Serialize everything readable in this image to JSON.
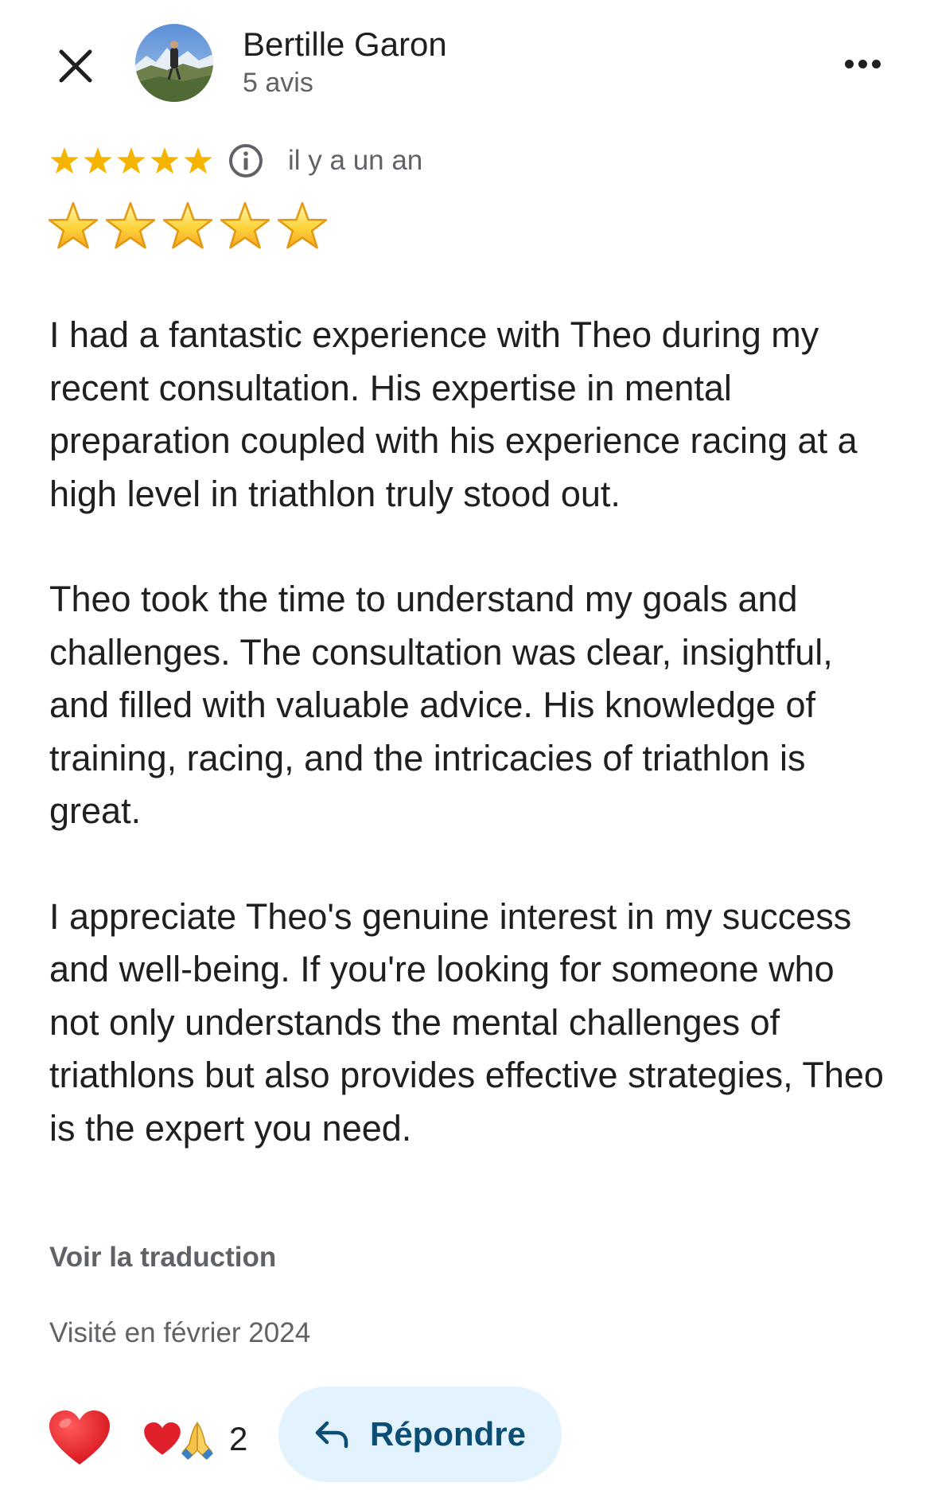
{
  "header": {
    "close_icon": "close-icon",
    "reviewer_name": "Bertille Garon",
    "review_count": "5 avis",
    "more_icon": "more-horizontal-icon"
  },
  "rating": {
    "stars": 5,
    "max_stars": 5,
    "star_color": "#f5b400",
    "info_icon": "info-icon",
    "time_ago": "il y a un an"
  },
  "emoji_stars": {
    "count": 5,
    "icon": "star-emoji"
  },
  "review": {
    "paragraphs": [
      "I had a fantastic experience with Theo during my recent consultation. His expertise in mental preparation coupled with his experience racing at a high level in triathlon truly stood out.",
      "Theo took the time to understand my goals and challenges. The consultation was clear, insightful, and filled with valuable advice. His knowledge of training, racing, and the intricacies of triathlon is great.",
      "I appreciate Theo's genuine interest in my success and well-being. If you're looking for someone who not only understands the mental challenges of triathlons but also provides effective strategies, Theo is the expert you need."
    ]
  },
  "translate_link": "Voir la traduction",
  "visited": "Visité en février 2024",
  "actions": {
    "react_icon": "heart-emoji-icon",
    "reactions": {
      "icons": [
        "heart-emoji",
        "praying-hands-emoji"
      ],
      "count": "2"
    },
    "reply_label": "Répondre",
    "reply_icon": "reply-arrow-icon",
    "reply_bg_color": "#e3f3fd",
    "reply_text_color": "#0b4d73"
  }
}
